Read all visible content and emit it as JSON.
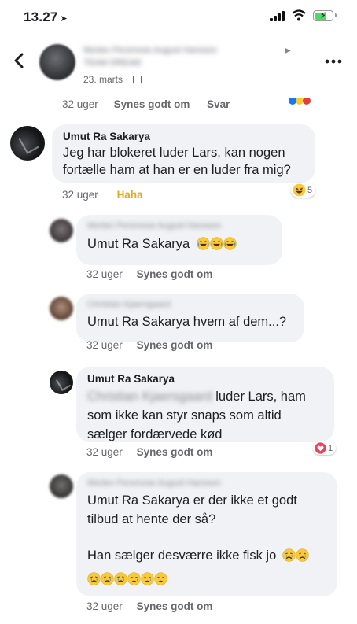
{
  "status": {
    "time": "13.27"
  },
  "colors": {
    "bubble": "#f0f2f5",
    "haha": "#e5a91f",
    "love": "#f33e58",
    "battery": "#4cd964"
  },
  "post": {
    "author_blurred": "Morten Persmose August Hansson",
    "author_sub_blurred": "TEAM DREAM",
    "date": "23. marts · "
  },
  "post_actions": {
    "time": "32 uger",
    "like": "Synes godt om",
    "reply": "Svar"
  },
  "comments": [
    {
      "name": "Umut Ra Sakarya",
      "text": "Jeg har blokeret luder Lars, kan nogen fortælle ham at han er en luder fra mig?",
      "time": "32 uger",
      "reaction_label": "Haha",
      "reaction_count": "5"
    },
    {
      "name_blurred": "Morten Persmose August Hansson",
      "text": "Umut Ra Sakarya",
      "time": "32 uger",
      "like": "Synes godt om"
    },
    {
      "name_blurred": "Christian Kjaersgaard",
      "text": "Umut Ra Sakarya hvem af dem...?",
      "time": "32 uger",
      "like": "Synes godt om"
    },
    {
      "name": "Umut Ra Sakarya",
      "text_blurred": "Christian Kjaersgaard",
      "text_line1": " luder Lars, ham",
      "text_rest": "som ikke kan styr snaps som altid sælger fordærvede kød",
      "time": "32 uger",
      "like": "Synes godt om",
      "reaction_count": "1"
    },
    {
      "name_blurred": "Morten Persmose August Hansson",
      "text_line1": "Umut Ra Sakarya  er der ikke et godt tilbud at hente der så?",
      "text_line2": "Han sælger desværre ikke fisk jo",
      "time": "32 uger",
      "like": "Synes godt om"
    }
  ],
  "icons": [
    "back-icon",
    "privacy-icon",
    "more-icon",
    "laughing-emoji",
    "crying-emoji",
    "sad-emoji",
    "love-reaction-icon",
    "haha-reaction-icon"
  ]
}
